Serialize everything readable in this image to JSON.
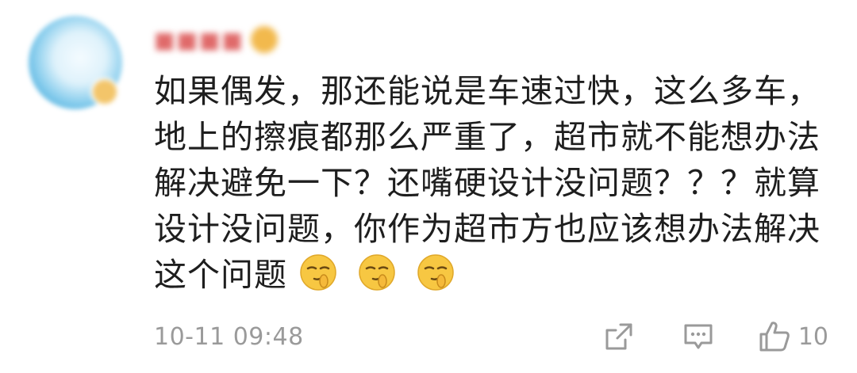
{
  "comment": {
    "lines": [
      "如果偶发，那还能说是车速过快，这么多车，",
      "地上的擦痕都那么严重了，超市就不能想办法",
      "解决避免一下？还嘴硬设计没问题？？？就算",
      "设计没问题，你作为超市方也应该想办法解决",
      "这个问题"
    ],
    "emojis": [
      "shush-face-emoji",
      "shush-face-emoji",
      "shush-face-emoji"
    ]
  },
  "footer": {
    "timestamp": "10-11 09:48",
    "like_count": "10"
  },
  "colors": {
    "text": "#1e1e1e",
    "meta": "#9a9a9a",
    "emoji_face": "#f7c742"
  }
}
